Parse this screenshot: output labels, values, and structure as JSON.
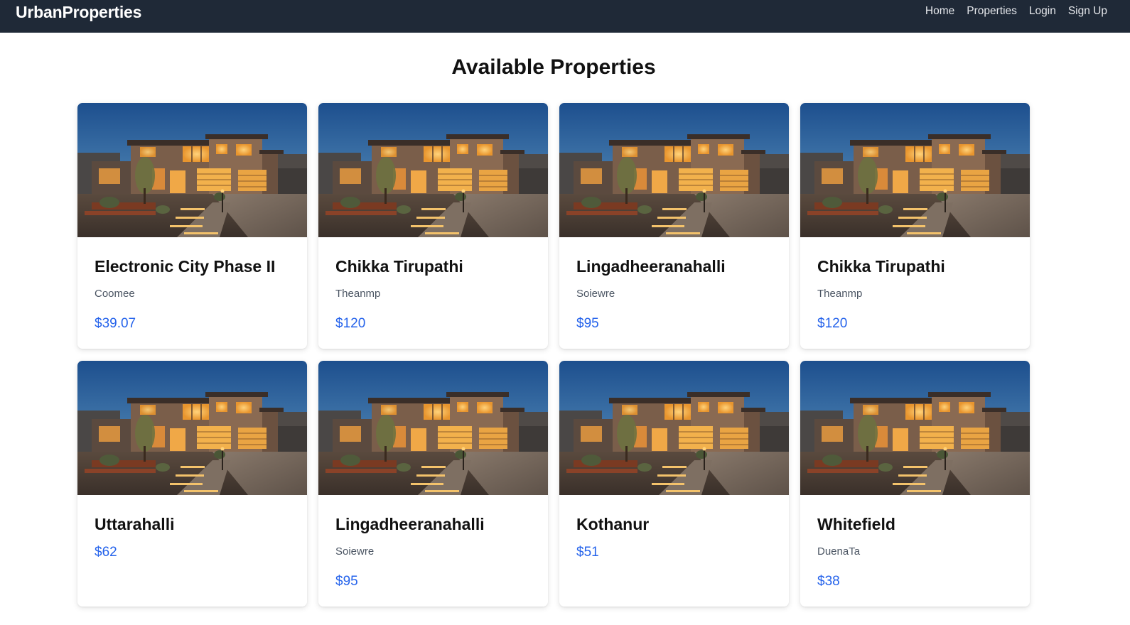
{
  "app": {
    "brand": "UrbanProperties",
    "nav": [
      {
        "label": "Home"
      },
      {
        "label": "Properties"
      },
      {
        "label": "Login"
      },
      {
        "label": "Sign Up"
      }
    ]
  },
  "page": {
    "title": "Available Properties"
  },
  "properties": [
    {
      "title": "Electronic City Phase II",
      "location": "Coomee",
      "price": "$39.07"
    },
    {
      "title": "Chikka Tirupathi",
      "location": "Theanmp",
      "price": "$120"
    },
    {
      "title": "Lingadheeranahalli",
      "location": "Soiewre",
      "price": "$95"
    },
    {
      "title": "Chikka Tirupathi",
      "location": "Theanmp",
      "price": "$120"
    },
    {
      "title": "Uttarahalli",
      "location": "",
      "price": "$62"
    },
    {
      "title": "Lingadheeranahalli",
      "location": "Soiewre",
      "price": "$95"
    },
    {
      "title": "Kothanur",
      "location": "",
      "price": "$51"
    },
    {
      "title": "Whitefield",
      "location": "DuenaTa",
      "price": "$38"
    }
  ],
  "colors": {
    "navbar": "#1f2937",
    "price": "#2563eb",
    "location": "#4b5563"
  }
}
